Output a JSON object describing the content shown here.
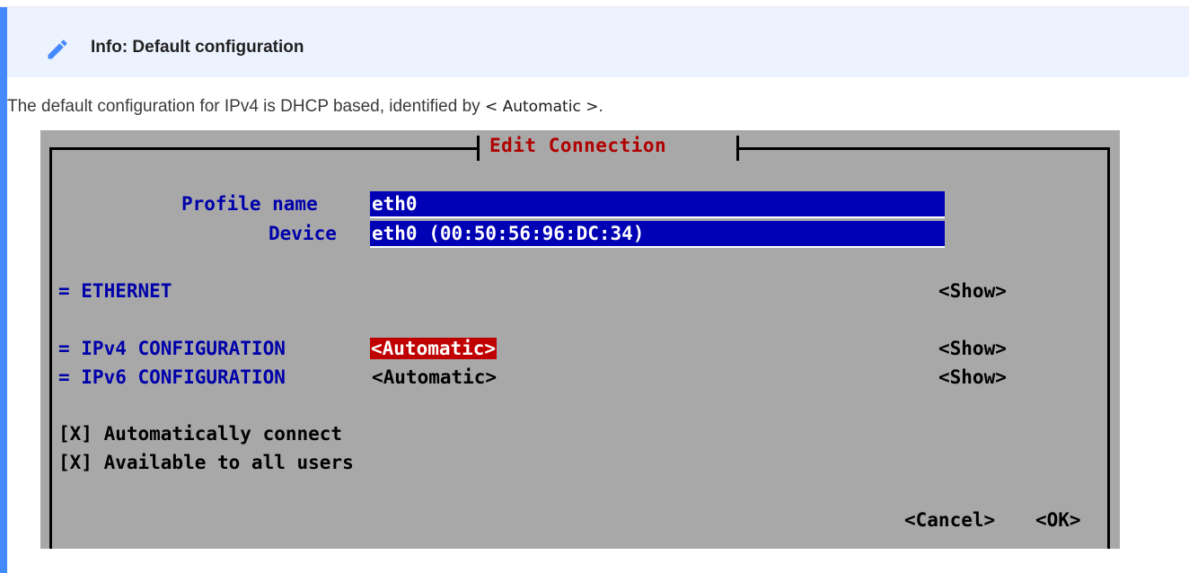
{
  "admonition": {
    "title": "Info: Default configuration",
    "icon": "pencil-icon",
    "text_before": "The default configuration for IPv4 is DHCP based, identified by ",
    "text_code": "< Automatic >",
    "text_after": ".",
    "accent": "#448aff",
    "header_bg": "#ecf3ff"
  },
  "terminal": {
    "title": "Edit Connection",
    "profile_name_label": "Profile name",
    "profile_name_value": "eth0",
    "device_label": "Device",
    "device_value": "eth0 (00:50:56:96:DC:34)",
    "ethernet_label": "= ETHERNET",
    "ethernet_show": "<Show>",
    "ipv4_label": "= IPv4 CONFIGURATION",
    "ipv4_value": "<Automatic>",
    "ipv4_show": "<Show>",
    "ipv6_label": "= IPv6 CONFIGURATION",
    "ipv6_value": "<Automatic>",
    "ipv6_show": "<Show>",
    "auto_connect": "[X] Automatically connect",
    "all_users": "[X] Available to all users",
    "cancel": "<Cancel>",
    "ok": "<OK>",
    "colors": {
      "background": "#a8a8a8",
      "field": "#0000b4",
      "selected": "#c00000",
      "label": "#0000aa",
      "title": "#b00000"
    }
  }
}
